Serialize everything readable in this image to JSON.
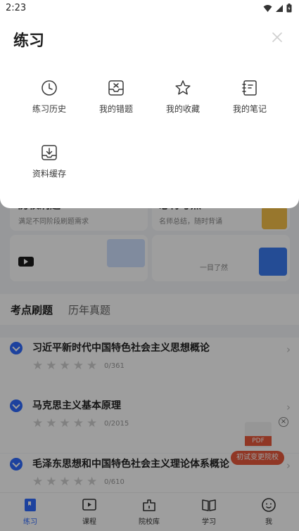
{
  "status_bar": {
    "time": "2:23"
  },
  "panel": {
    "title": "练习",
    "items": [
      {
        "label": "练习历史",
        "icon": "clock-icon"
      },
      {
        "label": "我的错题",
        "icon": "wrong-questions-inbox-icon"
      },
      {
        "label": "我的收藏",
        "icon": "star-icon"
      },
      {
        "label": "我的笔记",
        "icon": "notebook-icon"
      },
      {
        "label": "资料缓存",
        "icon": "download-tray-icon"
      }
    ]
  },
  "background": {
    "cards": [
      {
        "title": "历校刷题",
        "subtitle": "满足不同阶段刷题需求"
      },
      {
        "title": "必背考点",
        "subtitle": "名师总结，随时背诵"
      },
      {
        "title": "",
        "subtitle": "一目了然"
      }
    ],
    "tabs": [
      "考点刷题",
      "历年真题"
    ],
    "courses": [
      {
        "title": "习近平新时代中国特色社会主义思想概论",
        "progress": "0/361",
        "stars": 0
      },
      {
        "title": "马克思主义基本原理",
        "progress": "0/2015",
        "stars": 0
      },
      {
        "title": "毛泽东思想和中国特色社会主义理论体系概论",
        "progress": "0/610",
        "stars": 0
      }
    ],
    "pdf_promo": {
      "badge": "PDF",
      "cta": "初试变更院校"
    }
  },
  "bottom_nav": [
    {
      "label": "练习",
      "icon": "practice-icon",
      "active": true
    },
    {
      "label": "课程",
      "icon": "video-course-icon",
      "active": false
    },
    {
      "label": "院校库",
      "icon": "school-library-icon",
      "active": false
    },
    {
      "label": "学习",
      "icon": "book-icon",
      "active": false
    },
    {
      "label": "我",
      "icon": "profile-icon",
      "active": false
    }
  ],
  "colors": {
    "accent": "#2f6bff",
    "promo": "#e85a3c",
    "overlay": "rgba(0,0,0,0.38)"
  }
}
